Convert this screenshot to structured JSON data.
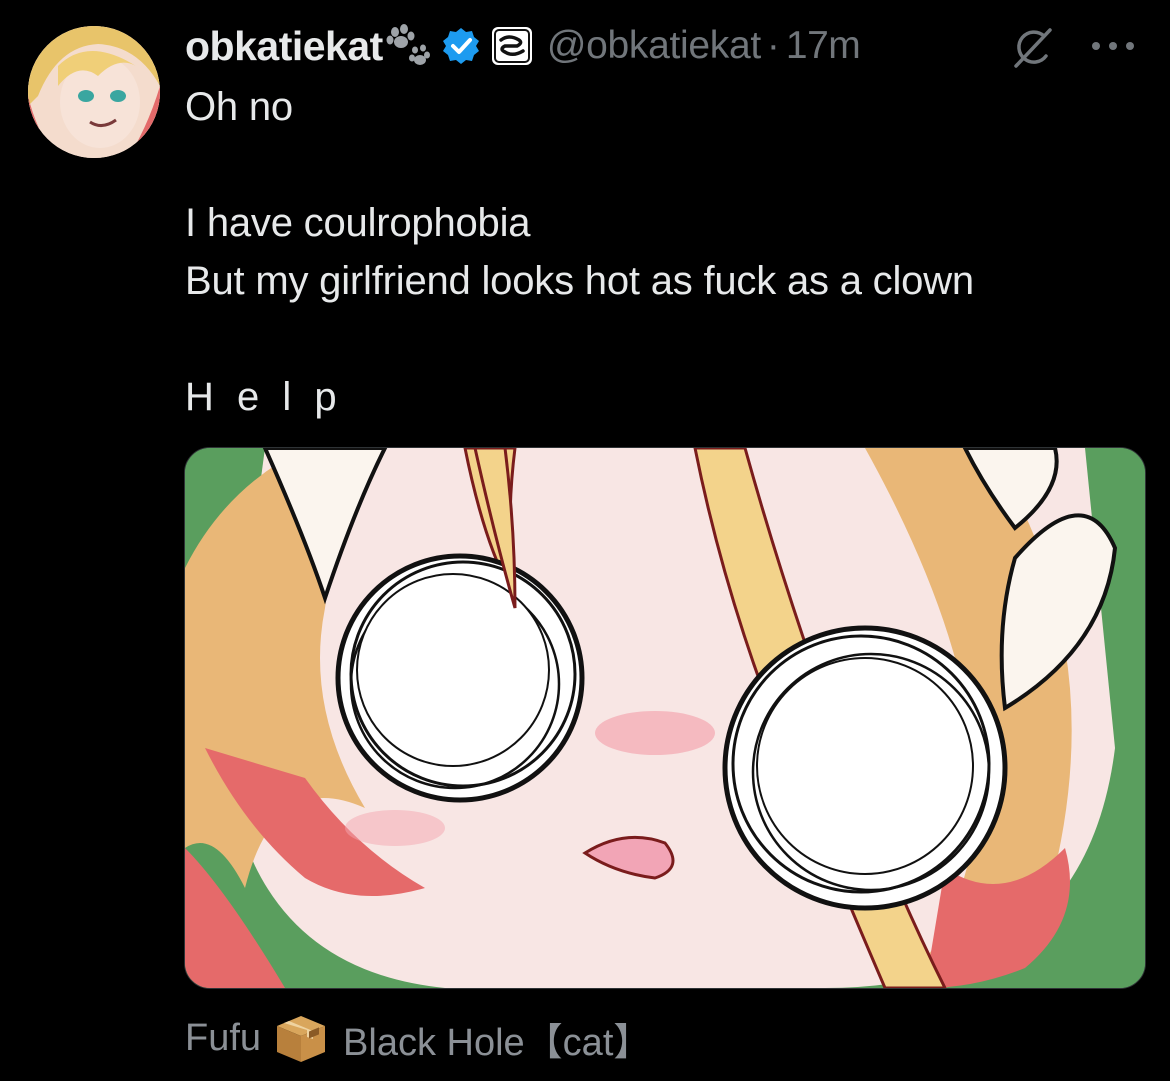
{
  "author": {
    "display_name": "obkatiekat",
    "handle": "@obkatiekat",
    "separator": "·",
    "timestamp": "17m",
    "icons": [
      "paw-icon",
      "verified-badge-icon",
      "affiliate-badge-icon"
    ],
    "verified_color": "#1d9bf0"
  },
  "actions": {
    "grok_icon": "grok-icon",
    "more_icon": "more-icon",
    "more_label": "···"
  },
  "tweet": {
    "line1": "Oh no",
    "line2": "I have coulrophobia",
    "line3": "But my girlfriend looks hot as fuck as a clown",
    "line4": "H e l p"
  },
  "media": {
    "icon": "anime-face-drawing",
    "background_color": "#5a9e5e"
  },
  "caption": {
    "before": "Fufu",
    "icon": "package-box-icon",
    "after": "Black Hole【cat】"
  },
  "colors": {
    "background": "#000000",
    "primary_text": "#e7e9ea",
    "secondary_text": "#71767b"
  }
}
